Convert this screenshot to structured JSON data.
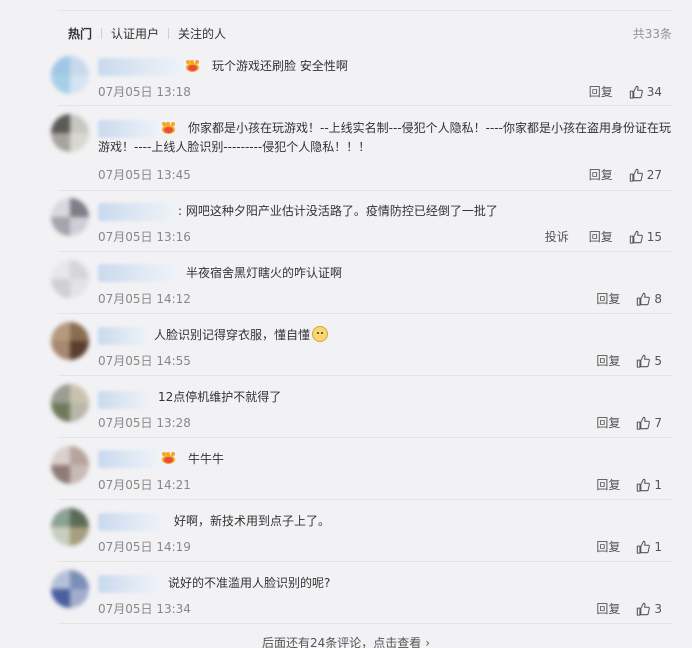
{
  "tabs": [
    {
      "label": "热门"
    },
    {
      "label": "认证用户"
    },
    {
      "label": "关注的人"
    }
  ],
  "total": "共33条",
  "comments": [
    {
      "text": "玩个游戏还刷脸 安全性啊",
      "time": "07月05日 13:18",
      "reply": "回复",
      "likes": "34"
    },
    {
      "text": "你家都是小孩在玩游戏！--上线实名制---侵犯个人隐私！----你家都是小孩在盗用身份证在玩游戏！----上线人脸识别---------侵犯个人隐私！！！",
      "time": "07月05日 13:45",
      "reply": "回复",
      "likes": "27"
    },
    {
      "text": "网吧这种夕阳产业估计没活路了。疫情防控已经倒了一批了",
      "time": "07月05日 13:16",
      "report": "投诉",
      "reply": "回复",
      "likes": "15"
    },
    {
      "text": "半夜宿舍黑灯瞎火的咋认证啊",
      "time": "07月05日 14:12",
      "reply": "回复",
      "likes": "8"
    },
    {
      "text": "人脸识别记得穿衣服，懂自懂",
      "time": "07月05日 14:55",
      "reply": "回复",
      "likes": "5"
    },
    {
      "text": "12点停机维护不就得了",
      "time": "07月05日 13:28",
      "reply": "回复",
      "likes": "7"
    },
    {
      "text": "牛牛牛",
      "time": "07月05日 14:21",
      "reply": "回复",
      "likes": "1"
    },
    {
      "text": "好啊，新技术用到点子上了。",
      "time": "07月05日 14:19",
      "reply": "回复",
      "likes": "1"
    },
    {
      "text": "说好的不准滥用人脸识别的呢?",
      "time": "07月05日 13:34",
      "reply": "回复",
      "likes": "3"
    }
  ],
  "footer": "后面还有24条评论，点击查看",
  "colors": {
    "background": "#f2f2f5",
    "text": "#333333",
    "time": "#888888",
    "crown": "#f5a623"
  }
}
